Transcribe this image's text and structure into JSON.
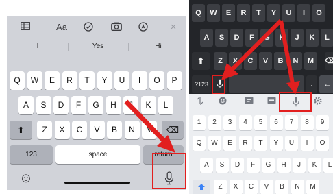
{
  "ios_keyboard": {
    "toolbar_icons": [
      "table-icon",
      "format-icon",
      "checklist-icon",
      "camera-icon",
      "markup-icon",
      "close-icon"
    ],
    "toolbar_format_label": "Aa",
    "toolbar_close_label": "×",
    "suggestions": [
      "I",
      "Yes",
      "Hi"
    ],
    "rows": [
      [
        "Q",
        "W",
        "E",
        "R",
        "T",
        "Y",
        "U",
        "I",
        "O",
        "P"
      ],
      [
        "A",
        "S",
        "D",
        "F",
        "G",
        "H",
        "J",
        "K",
        "L"
      ],
      [
        "Z",
        "X",
        "C",
        "V",
        "B",
        "N",
        "M"
      ]
    ],
    "shift_glyph": "⬆",
    "delete_glyph": "⌫",
    "numbers_label": "123",
    "space_label": "space",
    "return_label": "return",
    "emoji_glyph": "☺",
    "mic_icon": "microphone-icon"
  },
  "dark_keyboard": {
    "rows": [
      [
        "Q",
        "W",
        "E",
        "R",
        "T",
        "Y",
        "U",
        "I",
        "O"
      ],
      [
        "A",
        "S",
        "D",
        "F",
        "G",
        "H",
        "J",
        "K",
        "L"
      ],
      [
        "Z",
        "X",
        "C",
        "V",
        "B",
        "N",
        "M"
      ]
    ],
    "shift_glyph": "⬆",
    "delete_glyph": "⌫",
    "symbols_label": "?123",
    "period_label": ".",
    "enter_glyph": "←",
    "mic_icon": "microphone-icon"
  },
  "light_keyboard": {
    "toolbar_icons": [
      "translate-icon",
      "emoji-icon",
      "gif-icon",
      "clipboard-icon",
      "microphone-icon",
      "settings-icon"
    ],
    "number_row": [
      "1",
      "2",
      "3",
      "4",
      "5",
      "6",
      "7",
      "8",
      "9"
    ],
    "rows": [
      [
        "Q",
        "W",
        "E",
        "R",
        "T",
        "Y",
        "U",
        "I",
        "O"
      ],
      [
        "A",
        "S",
        "D",
        "F",
        "G",
        "H",
        "J",
        "K",
        "L"
      ]
    ],
    "partial_row": [
      "Z",
      "X",
      "C",
      "V",
      "B",
      "N",
      "M"
    ]
  },
  "colors": {
    "highlight": "#e21f1f",
    "ios_background": "#d1d3d9",
    "dark_background": "#232529",
    "light_background": "#eceef1"
  }
}
